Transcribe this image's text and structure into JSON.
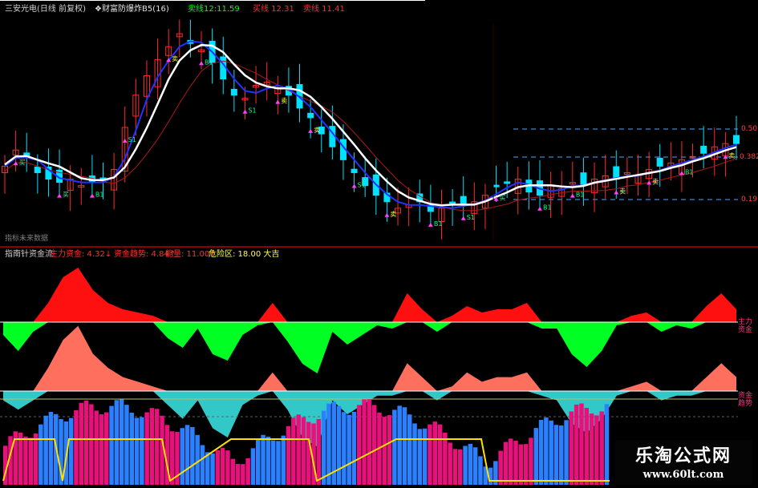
{
  "header": {
    "symbol": "三安光电(日线 前复权)",
    "indicator": "❖财富防爆炸B5(16)",
    "sell1": "卖线12:11.59",
    "buy": "买线 12.31",
    "sell2": "卖线 11.41"
  },
  "price_labels": {
    "l1": "0.50",
    "l2": "0.382",
    "l3": "0.191",
    "marks": [
      "买",
      "买",
      "B1",
      "S1",
      "卖",
      "B1",
      "S1",
      "卖",
      "卖",
      "S1",
      "卖",
      "B1",
      "S1",
      "买",
      "B1",
      "B1",
      "卖",
      "卖",
      "B1",
      "卖"
    ]
  },
  "divider_text": "指标未来数据",
  "subchart_header": {
    "name": "指南针资金流",
    "main_fund": "主力资金: 4.32↓",
    "trend": "资金趋势: 4.84↑",
    "energy": "能量: 11.00↑",
    "danger": "危险区: 18.00 大吉"
  },
  "right_tags": {
    "main": "主力资金",
    "trend": "资金趋势"
  },
  "watermark": {
    "cn": "乐淘公式网",
    "url": "www.60lt.com"
  },
  "colors": {
    "up": "#ff2a2a",
    "down": "#00e0ff",
    "ma_white": "#ffffff",
    "ma_blue": "#2233ff",
    "ma_red": "#b01818",
    "green_fill": "#00ff22",
    "red_fill": "#ff1010",
    "salmon": "#ff6f5e",
    "teal": "#32c8c8",
    "pink_bar": "#e8107a",
    "blue_bar": "#2a80ff",
    "yellow": "#ffe000"
  },
  "chart_data": [
    {
      "type": "candlestick",
      "title": "三安光电(日线 前复权)",
      "close": [
        9.8,
        10.3,
        10.1,
        9.6,
        9.4,
        9.3,
        9.4,
        9.2,
        9.3,
        9.4,
        9.7,
        11.0,
        12.0,
        12.6,
        13.1,
        13.5,
        13.9,
        13.6,
        13.4,
        13.0,
        12.5,
        12.0,
        11.9,
        12.3,
        12.4,
        12.2,
        12.0,
        11.6,
        11.3,
        10.8,
        10.4,
        10.0,
        9.6,
        9.2,
        8.9,
        8.7,
        8.5,
        8.6,
        8.7,
        8.4,
        8.5,
        8.6,
        8.6,
        8.7,
        8.9,
        9.2,
        9.3,
        9.4,
        9.0,
        8.9,
        9.2,
        9.1,
        9.3,
        9.2,
        9.4,
        9.5,
        9.4,
        9.6,
        9.5,
        9.7,
        9.8,
        9.9,
        10.0,
        10.1,
        10.2,
        10.4,
        10.5,
        10.5
      ],
      "ma_levels": [
        "0.50",
        "0.382",
        "0.191"
      ]
    },
    {
      "type": "area",
      "title": "指南针资金流",
      "series": [
        {
          "name": "主力资金",
          "values": [
            -4,
            -9,
            -3,
            6,
            14,
            17,
            10,
            6,
            4,
            3,
            2,
            -5,
            -8,
            -2,
            -10,
            -12,
            -4,
            -1,
            6,
            -6,
            -13,
            -16,
            -3,
            -7,
            -4,
            -1,
            -2,
            9,
            4,
            -3,
            2,
            5,
            3,
            4,
            4,
            6,
            -2,
            -2,
            -10,
            -14,
            -9,
            -1,
            2,
            3,
            -3,
            -1,
            -2,
            5,
            9,
            4
          ]
        },
        {
          "name": "资金趋势",
          "values": [
            -2,
            -4,
            -2,
            5,
            11,
            14,
            8,
            5,
            3,
            2,
            1,
            -3,
            -6,
            -2,
            -8,
            -10,
            -3,
            -1,
            4,
            -4,
            -10,
            -12,
            -2,
            -5,
            -3,
            -1,
            -1,
            6,
            3,
            -2,
            1,
            4,
            2,
            3,
            3,
            4,
            -1,
            -2,
            -7,
            -9,
            -6,
            -1,
            1,
            2,
            -2,
            -1,
            -1,
            3,
            6,
            3
          ]
        }
      ]
    }
  ]
}
